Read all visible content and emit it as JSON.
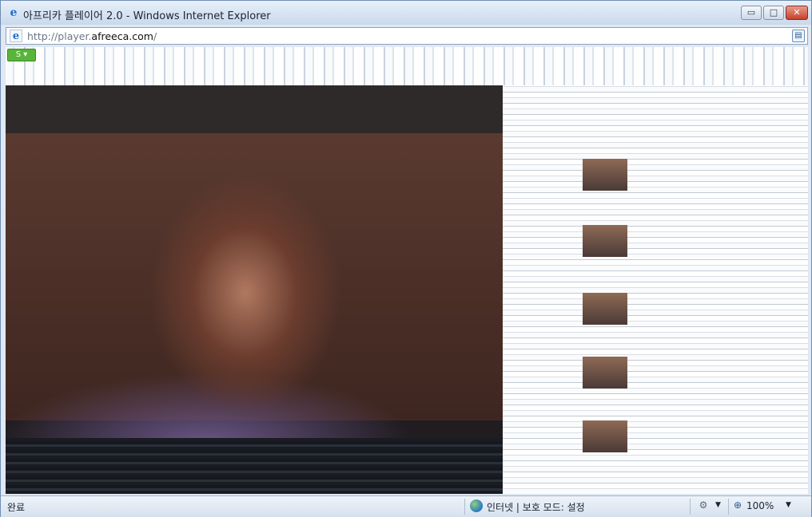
{
  "window": {
    "title": "아프리카 플레이어 2.0 - Windows Internet Explorer",
    "minimize_glyph": "▭",
    "maximize_glyph": "□",
    "close_glyph": "✕"
  },
  "address": {
    "url_prefix": "http://player.",
    "url_domain": "afreeca.com",
    "url_suffix": "/"
  },
  "status": {
    "text": "완료",
    "zone": "인터넷 | 보호 모드: 설정",
    "zoom": "100%"
  },
  "icons": {
    "page": "ie-page-icon",
    "globe": "internet-zone-globe-icon",
    "compat": "compatibility-view-icon",
    "zoom": "zoom-magnifier-icon",
    "security": "security-icon"
  },
  "colors": {
    "chrome": "#dfe8f3",
    "status_bar": "#d6e1ee",
    "close_button": "#c6402a",
    "menu_green": "#58b53a"
  }
}
